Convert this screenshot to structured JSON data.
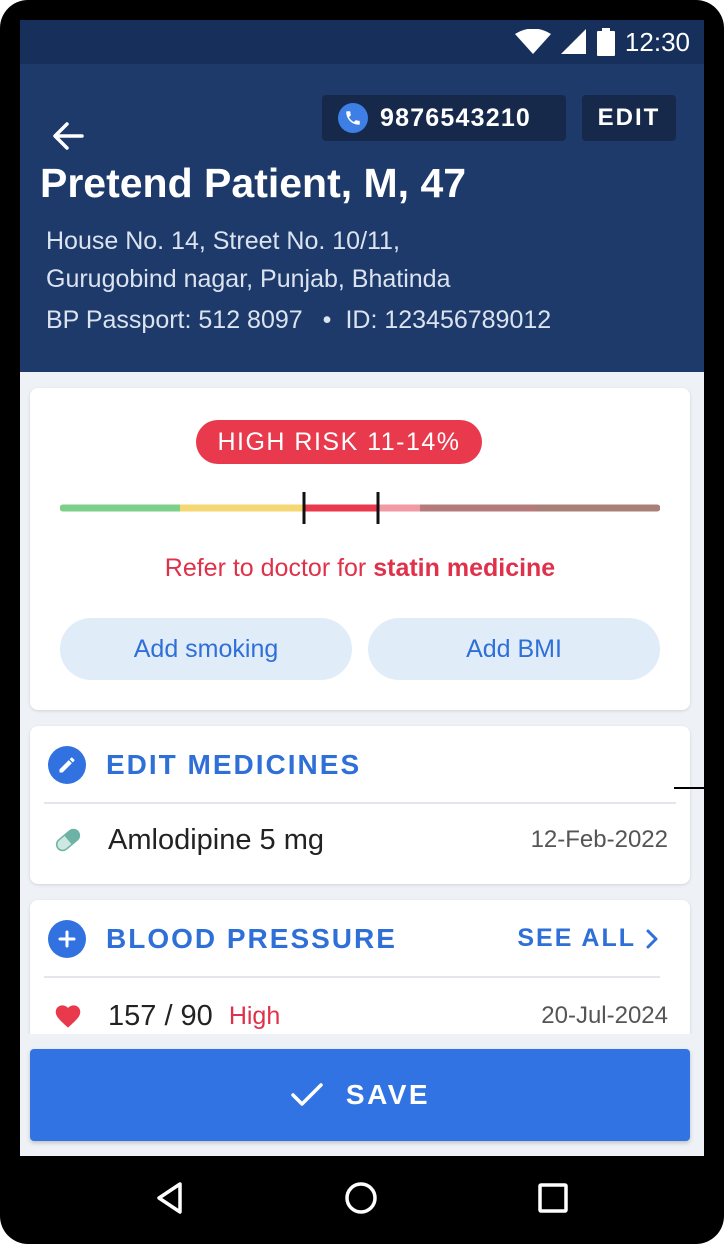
{
  "status_bar": {
    "time": "12:30",
    "icons": [
      "wifi-icon",
      "signal-icon",
      "battery-icon"
    ]
  },
  "header": {
    "phone_number": "9876543210",
    "edit_label": "EDIT",
    "patient_name": "Pretend Patient, M, 47",
    "address_line1": "House No. 14, Street No. 10/11,",
    "address_line2": "Gurugobind nagar, Punjab, Bhatinda",
    "bp_passport": "BP Passport: 512 8097",
    "separator": "•",
    "patient_id": "ID: 123456789012"
  },
  "risk": {
    "badge": "HIGH RISK 11-14%",
    "advice_prefix": "Refer to doctor for ",
    "advice_bold": "statin medicine",
    "add_smoking": "Add smoking",
    "add_bmi": "Add BMI",
    "segment_colors": [
      "#7ecf8a",
      "#f5d774",
      "#e8394d",
      "#f09aa4",
      "#b57b7b",
      "#a88078"
    ]
  },
  "medicines": {
    "title": "EDIT MEDICINES",
    "items": [
      {
        "name": "Amlodipine 5 mg",
        "date": "12-Feb-2022"
      }
    ]
  },
  "blood_pressure": {
    "title": "BLOOD PRESSURE",
    "see_all": "SEE ALL",
    "items": [
      {
        "reading": "157 / 90",
        "status": "High",
        "date": "20-Jul-2024"
      }
    ]
  },
  "save_label": "SAVE",
  "colors": {
    "header": "#1d3a6b",
    "accent": "#3273e3",
    "danger": "#e8394d"
  }
}
